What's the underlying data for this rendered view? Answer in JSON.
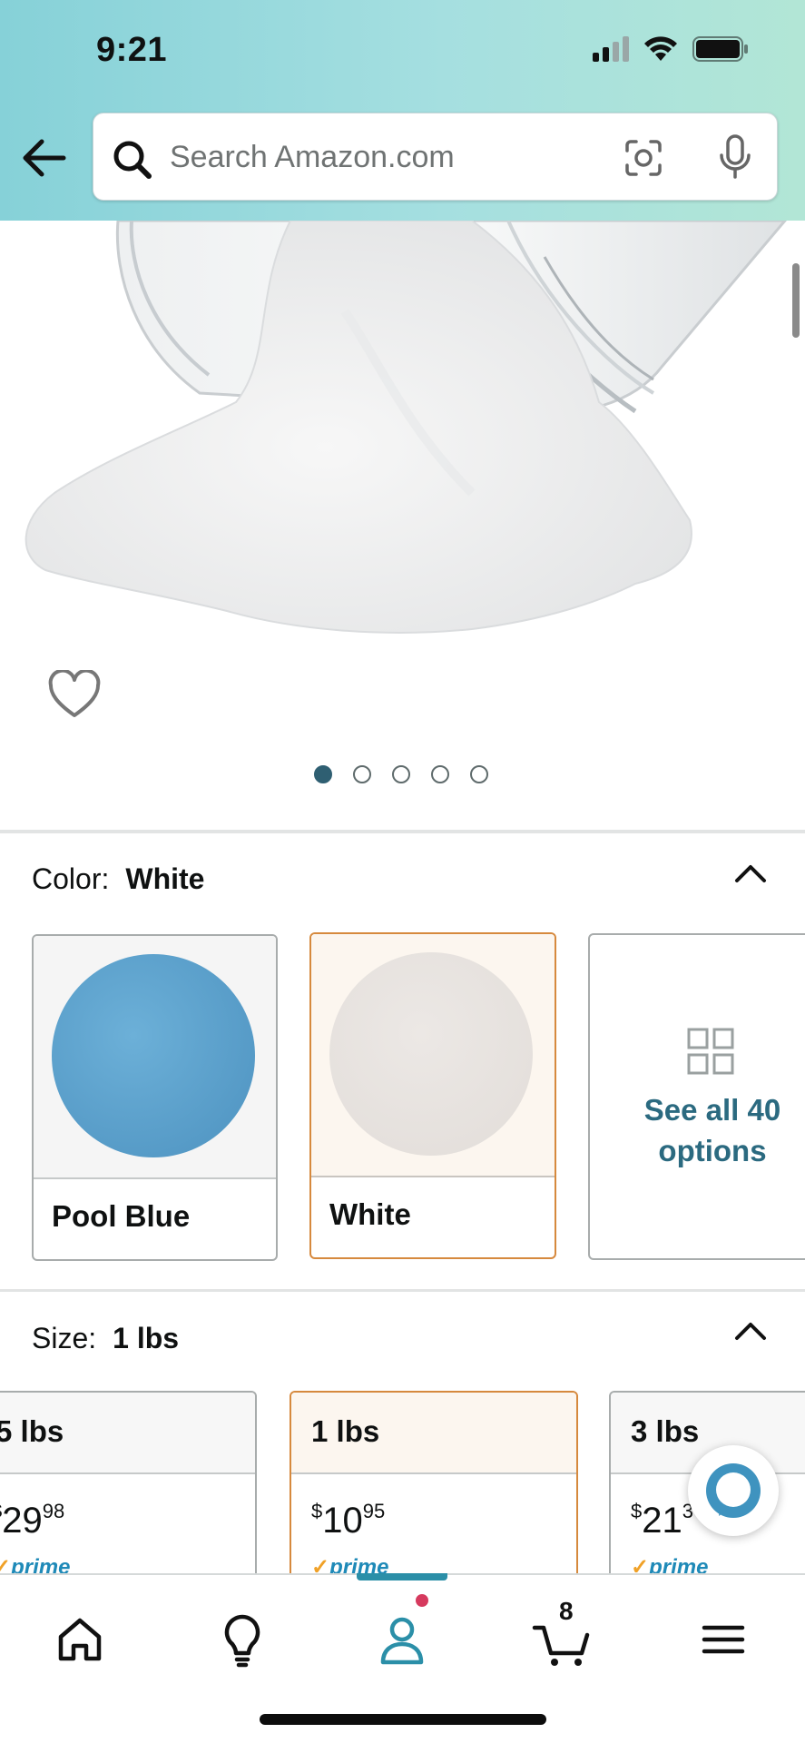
{
  "status_bar": {
    "time": "9:21"
  },
  "search": {
    "placeholder": "Search Amazon.com"
  },
  "gallery": {
    "image_count": 5,
    "active_index": 0
  },
  "color": {
    "label": "Color:",
    "value": "White",
    "options": [
      {
        "name": "Pool Blue",
        "swatch_color": "#5ba3cf",
        "selected": false
      },
      {
        "name": "White",
        "swatch_color": "#e8e3df",
        "selected": true
      }
    ],
    "see_all_label": "See all 40 options"
  },
  "size": {
    "label": "Size:",
    "value": "1 lbs",
    "options": [
      {
        "name": "5 lbs",
        "price_dollars": "29",
        "price_cents": "98",
        "prime": "prime",
        "selected": false
      },
      {
        "name": "1 lbs",
        "price_dollars": "10",
        "price_cents": "95",
        "prime": "prime",
        "selected": true
      },
      {
        "name": "3 lbs",
        "price_dollars": "21",
        "price_cents": "3",
        "prime": "prime",
        "selected": false
      }
    ]
  },
  "bottom_nav": {
    "items": [
      "home-icon",
      "lightbulb-icon",
      "account-icon",
      "cart-icon",
      "menu-icon"
    ],
    "active": "account-icon",
    "cart_count": "8"
  },
  "colors": {
    "accent_teal": "#2b6a80",
    "selected_border": "#d6893d",
    "prime_blue": "#1f8ab8"
  }
}
